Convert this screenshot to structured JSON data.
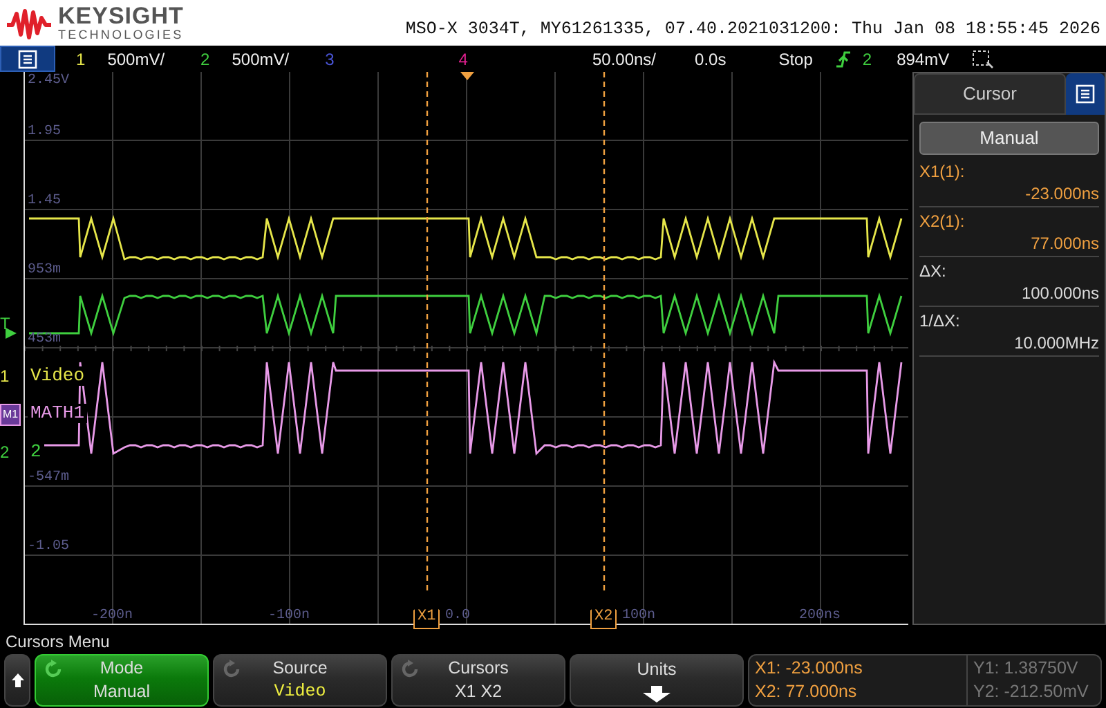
{
  "header": {
    "brand": "KEYSIGHT",
    "brand_sub": "TECHNOLOGIES",
    "instrument_info": "MSO-X 3034T, MY61261335, 07.40.2021031200: Thu Jan 08 18:55:45 2026"
  },
  "status_bar": {
    "channels": [
      {
        "number": "1",
        "scale": "500mV/",
        "color": "#e6e64a"
      },
      {
        "number": "2",
        "scale": "500mV/",
        "color": "#3fcf3f"
      },
      {
        "number": "3",
        "color": "#4a55d8"
      },
      {
        "number": "4",
        "color": "#e0208f"
      }
    ],
    "timebase": "50.00ns/",
    "delay": "0.0s",
    "run_state": "Stop",
    "trigger_source": "2",
    "trigger_level": "894mV"
  },
  "display": {
    "y_labels": [
      "2.45V",
      "1.95",
      "1.45",
      "953m",
      "453m",
      "-547m",
      "-1.05"
    ],
    "x_labels": [
      "-200n",
      "-100n",
      "0.0",
      "100n",
      "200ns"
    ],
    "trigger_marker": "T",
    "channel_labels": [
      {
        "marker": "1",
        "label": "Video",
        "color": "#e6e64a"
      },
      {
        "marker": "M1",
        "label": "MATH1",
        "color": "#e89ae8"
      },
      {
        "marker": "2",
        "label": "2",
        "color": "#3fcf3f"
      }
    ],
    "cursor_markers": [
      "X1",
      "X2"
    ]
  },
  "side_panel": {
    "title": "Cursor",
    "mode_button": "Manual",
    "readouts": [
      {
        "label": "X1(1):",
        "value": "-23.000ns",
        "kind": "cursor"
      },
      {
        "label": "X2(1):",
        "value": "77.000ns",
        "kind": "cursor"
      },
      {
        "label": "ΔX:",
        "value": "100.000ns",
        "kind": "delta"
      },
      {
        "label": "1/ΔX:",
        "value": "10.000MHz",
        "kind": "delta"
      }
    ]
  },
  "menu": {
    "title": "Cursors Menu",
    "softkeys": [
      {
        "label": "Mode",
        "value": "Manual",
        "kind": "text",
        "adjustable": true,
        "selected": true
      },
      {
        "label": "Source",
        "value": "Video",
        "kind": "channel",
        "adjustable": true,
        "selected": false
      },
      {
        "label": "Cursors",
        "value": "X1 X2",
        "kind": "text",
        "adjustable": true,
        "selected": false
      },
      {
        "label": "Units",
        "kind": "arrow",
        "adjustable": false,
        "selected": false
      }
    ],
    "readouts": [
      {
        "text": "X1: -23.000ns",
        "kind": "x"
      },
      {
        "text": "X2: 77.000ns",
        "kind": "x"
      },
      {
        "text": "Y1: 1.38750V",
        "kind": "y"
      },
      {
        "text": "Y2: -212.50mV",
        "kind": "y"
      }
    ]
  }
}
